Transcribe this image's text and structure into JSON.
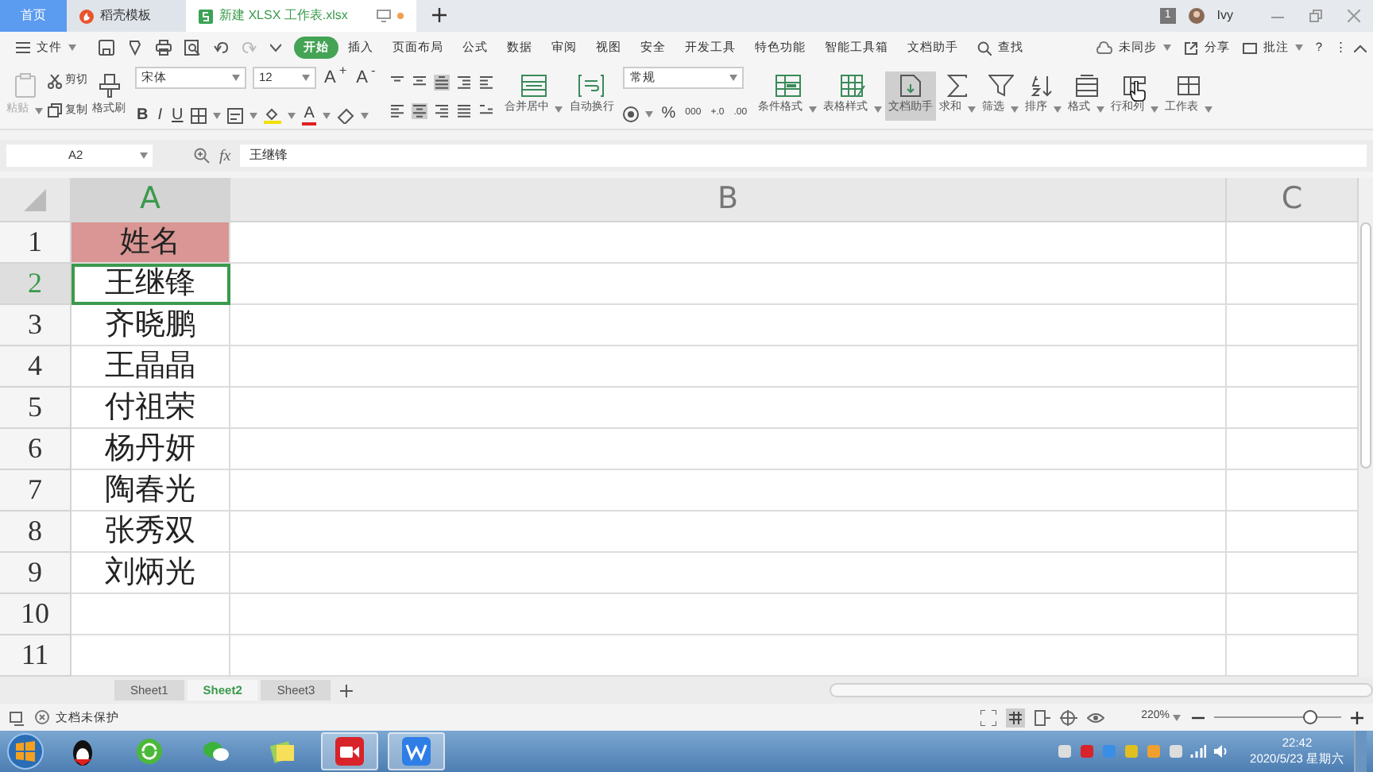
{
  "window_tabs": [
    {
      "label": "首页",
      "kind": "home",
      "selected": false
    },
    {
      "label": "稻壳模板",
      "kind": "docer",
      "selected": false
    },
    {
      "label": "新建 XLSX 工作表.xlsx",
      "kind": "sheet",
      "selected": true
    }
  ],
  "title_bar": {
    "notice_count": "1",
    "user": "Ivy"
  },
  "menu": {
    "file": "文件",
    "tabs": [
      {
        "label": "开始",
        "selected": true
      },
      {
        "label": "插入",
        "selected": false
      },
      {
        "label": "页面布局",
        "selected": false
      },
      {
        "label": "公式",
        "selected": false
      },
      {
        "label": "数据",
        "selected": false
      },
      {
        "label": "审阅",
        "selected": false
      },
      {
        "label": "视图",
        "selected": false
      },
      {
        "label": "安全",
        "selected": false
      },
      {
        "label": "开发工具",
        "selected": false
      },
      {
        "label": "特色功能",
        "selected": false
      },
      {
        "label": "智能工具箱",
        "selected": false
      },
      {
        "label": "文档助手",
        "selected": false
      }
    ],
    "search": "查找",
    "sync": "未同步",
    "share": "分享",
    "comment": "批注",
    "help": "?",
    "more": "⋮"
  },
  "ribbon": {
    "paste": {
      "label": "粘贴",
      "disabled": true
    },
    "cut": "剪切",
    "copy": "复制",
    "painter": "格式刷",
    "font": "宋体",
    "font_size": "12",
    "size_buttons": [
      "A$^{+}$",
      "A$^{-}$"
    ],
    "font_styles": [
      "B",
      "I",
      "U"
    ],
    "font_color": "A",
    "merge": "合并居中",
    "wrap": "自动换行",
    "number_format": "常规",
    "number_buttons": [
      "%",
      "000",
      "+.0",
      ".00"
    ],
    "tools": [
      {
        "label": "条件格式",
        "selected": false
      },
      {
        "label": "表格样式",
        "selected": false
      },
      {
        "label": "文档助手",
        "selected": true
      },
      {
        "label": "求和",
        "selected": false
      },
      {
        "label": "筛选",
        "selected": false
      },
      {
        "label": "排序",
        "selected": false
      },
      {
        "label": "格式",
        "selected": false
      },
      {
        "label": "行和列",
        "selected": false
      },
      {
        "label": "工作表",
        "selected": false
      }
    ]
  },
  "formula_bar": {
    "cell": "A2",
    "fx": "fx",
    "value": "王继锋"
  },
  "columns": [
    {
      "label": "A",
      "selected": true
    },
    {
      "label": "B",
      "selected": false
    },
    {
      "label": "C",
      "selected": false
    }
  ],
  "rows": [
    {
      "number": "1",
      "value": "姓名",
      "filled": true,
      "selected": false
    },
    {
      "number": "2",
      "value": "王继锋",
      "filled": false,
      "selected": true
    },
    {
      "number": "3",
      "value": "齐晓鹏",
      "filled": false,
      "selected": false
    },
    {
      "number": "4",
      "value": "王晶晶",
      "filled": false,
      "selected": false
    },
    {
      "number": "5",
      "value": "付祖荣",
      "filled": false,
      "selected": false
    },
    {
      "number": "6",
      "value": "杨丹妍",
      "filled": false,
      "selected": false
    },
    {
      "number": "7",
      "value": "陶春光",
      "filled": false,
      "selected": false
    },
    {
      "number": "8",
      "value": "张秀双",
      "filled": false,
      "selected": false
    },
    {
      "number": "9",
      "value": "刘炳光",
      "filled": false,
      "selected": false
    },
    {
      "number": "10",
      "filled": false,
      "selected": false
    },
    {
      "number": "11",
      "filled": false,
      "selected": false
    }
  ],
  "sheets": [
    {
      "label": "Sheet1",
      "selected": false
    },
    {
      "label": "Sheet2",
      "selected": true
    },
    {
      "label": "Sheet3",
      "selected": false
    }
  ],
  "status": {
    "protection": "文档未保护",
    "zoom": "220%",
    "zoom_slider": {
      "level": 0.75
    }
  },
  "clock": {
    "time": "22:42",
    "date": "2020/5/23 星期六"
  }
}
